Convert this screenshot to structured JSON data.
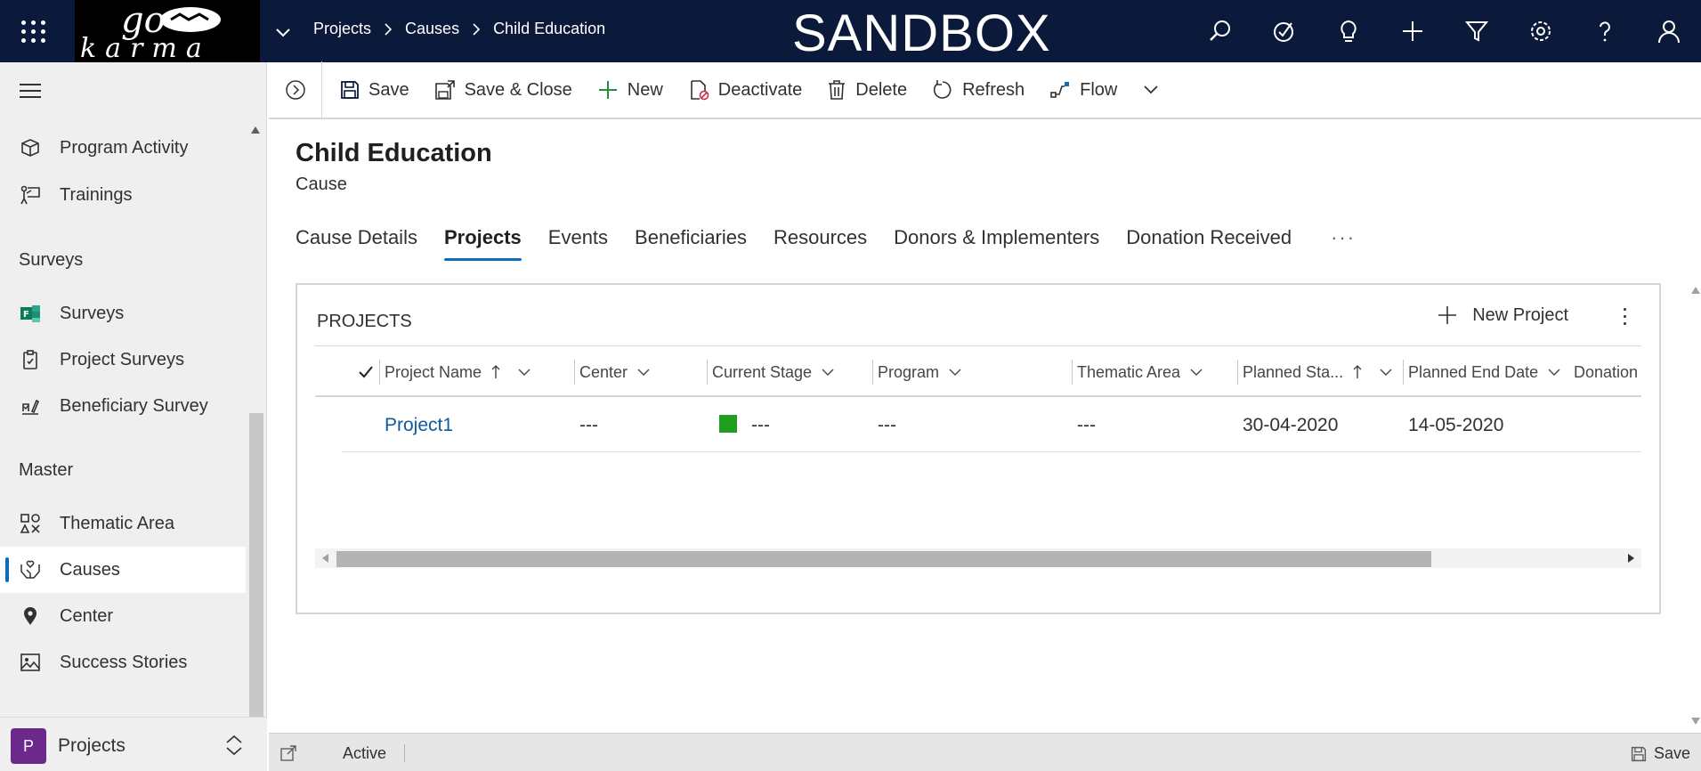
{
  "header": {
    "environment_label": "SANDBOX",
    "logo_text": "go karma",
    "breadcrumb": [
      "Projects",
      "Causes",
      "Child Education"
    ],
    "icons": [
      "search-icon",
      "task-icon",
      "lightbulb-icon",
      "plus-icon",
      "filter-icon",
      "settings-icon",
      "help-icon",
      "user-icon"
    ]
  },
  "sidebar": {
    "items_top": [
      {
        "label": "Program Activity",
        "icon": "box-icon"
      },
      {
        "label": "Trainings",
        "icon": "presenter-icon"
      }
    ],
    "section_surveys": "Surveys",
    "items_surveys": [
      {
        "label": "Surveys",
        "icon": "forms-icon"
      },
      {
        "label": "Project Surveys",
        "icon": "clipboard-icon"
      },
      {
        "label": "Beneficiary Survey",
        "icon": "survey-icon"
      }
    ],
    "section_master": "Master",
    "items_master": [
      {
        "label": "Thematic Area",
        "icon": "shapes-icon"
      },
      {
        "label": "Causes",
        "icon": "hands-heart-icon"
      },
      {
        "label": "Center",
        "icon": "location-pin-icon"
      },
      {
        "label": "Success Stories",
        "icon": "image-icon"
      }
    ],
    "area": {
      "badge": "P",
      "name": "Projects"
    }
  },
  "commands": {
    "save": "Save",
    "save_close": "Save & Close",
    "new": "New",
    "deactivate": "Deactivate",
    "delete": "Delete",
    "refresh": "Refresh",
    "flow": "Flow"
  },
  "record": {
    "title": "Child Education",
    "entity": "Cause",
    "tabs": [
      "Cause Details",
      "Projects",
      "Events",
      "Beneficiaries",
      "Resources",
      "Donors & Implementers",
      "Donation Received"
    ],
    "active_tab": "Projects",
    "tab_more": "···"
  },
  "grid": {
    "title": "PROJECTS",
    "new_label": "New Project",
    "columns": [
      "Project Name",
      "Center",
      "Current Stage",
      "Program",
      "Thematic Area",
      "Planned Sta...",
      "Planned End Date",
      "Donation"
    ],
    "rows": [
      {
        "project_name": "Project1",
        "center": "---",
        "current_stage": "---",
        "program": "---",
        "thematic_area": "---",
        "planned_start": "30-04-2020",
        "planned_end": "14-05-2020",
        "donation": ""
      }
    ],
    "stage_color": "#1f9d1f"
  },
  "status": {
    "state": "Active",
    "save_label": "Save"
  },
  "colors": {
    "topbar": "#0b1a3a",
    "accent": "#0f6cbd",
    "link": "#0f5a9c",
    "area_badge": "#6b2a8b"
  }
}
